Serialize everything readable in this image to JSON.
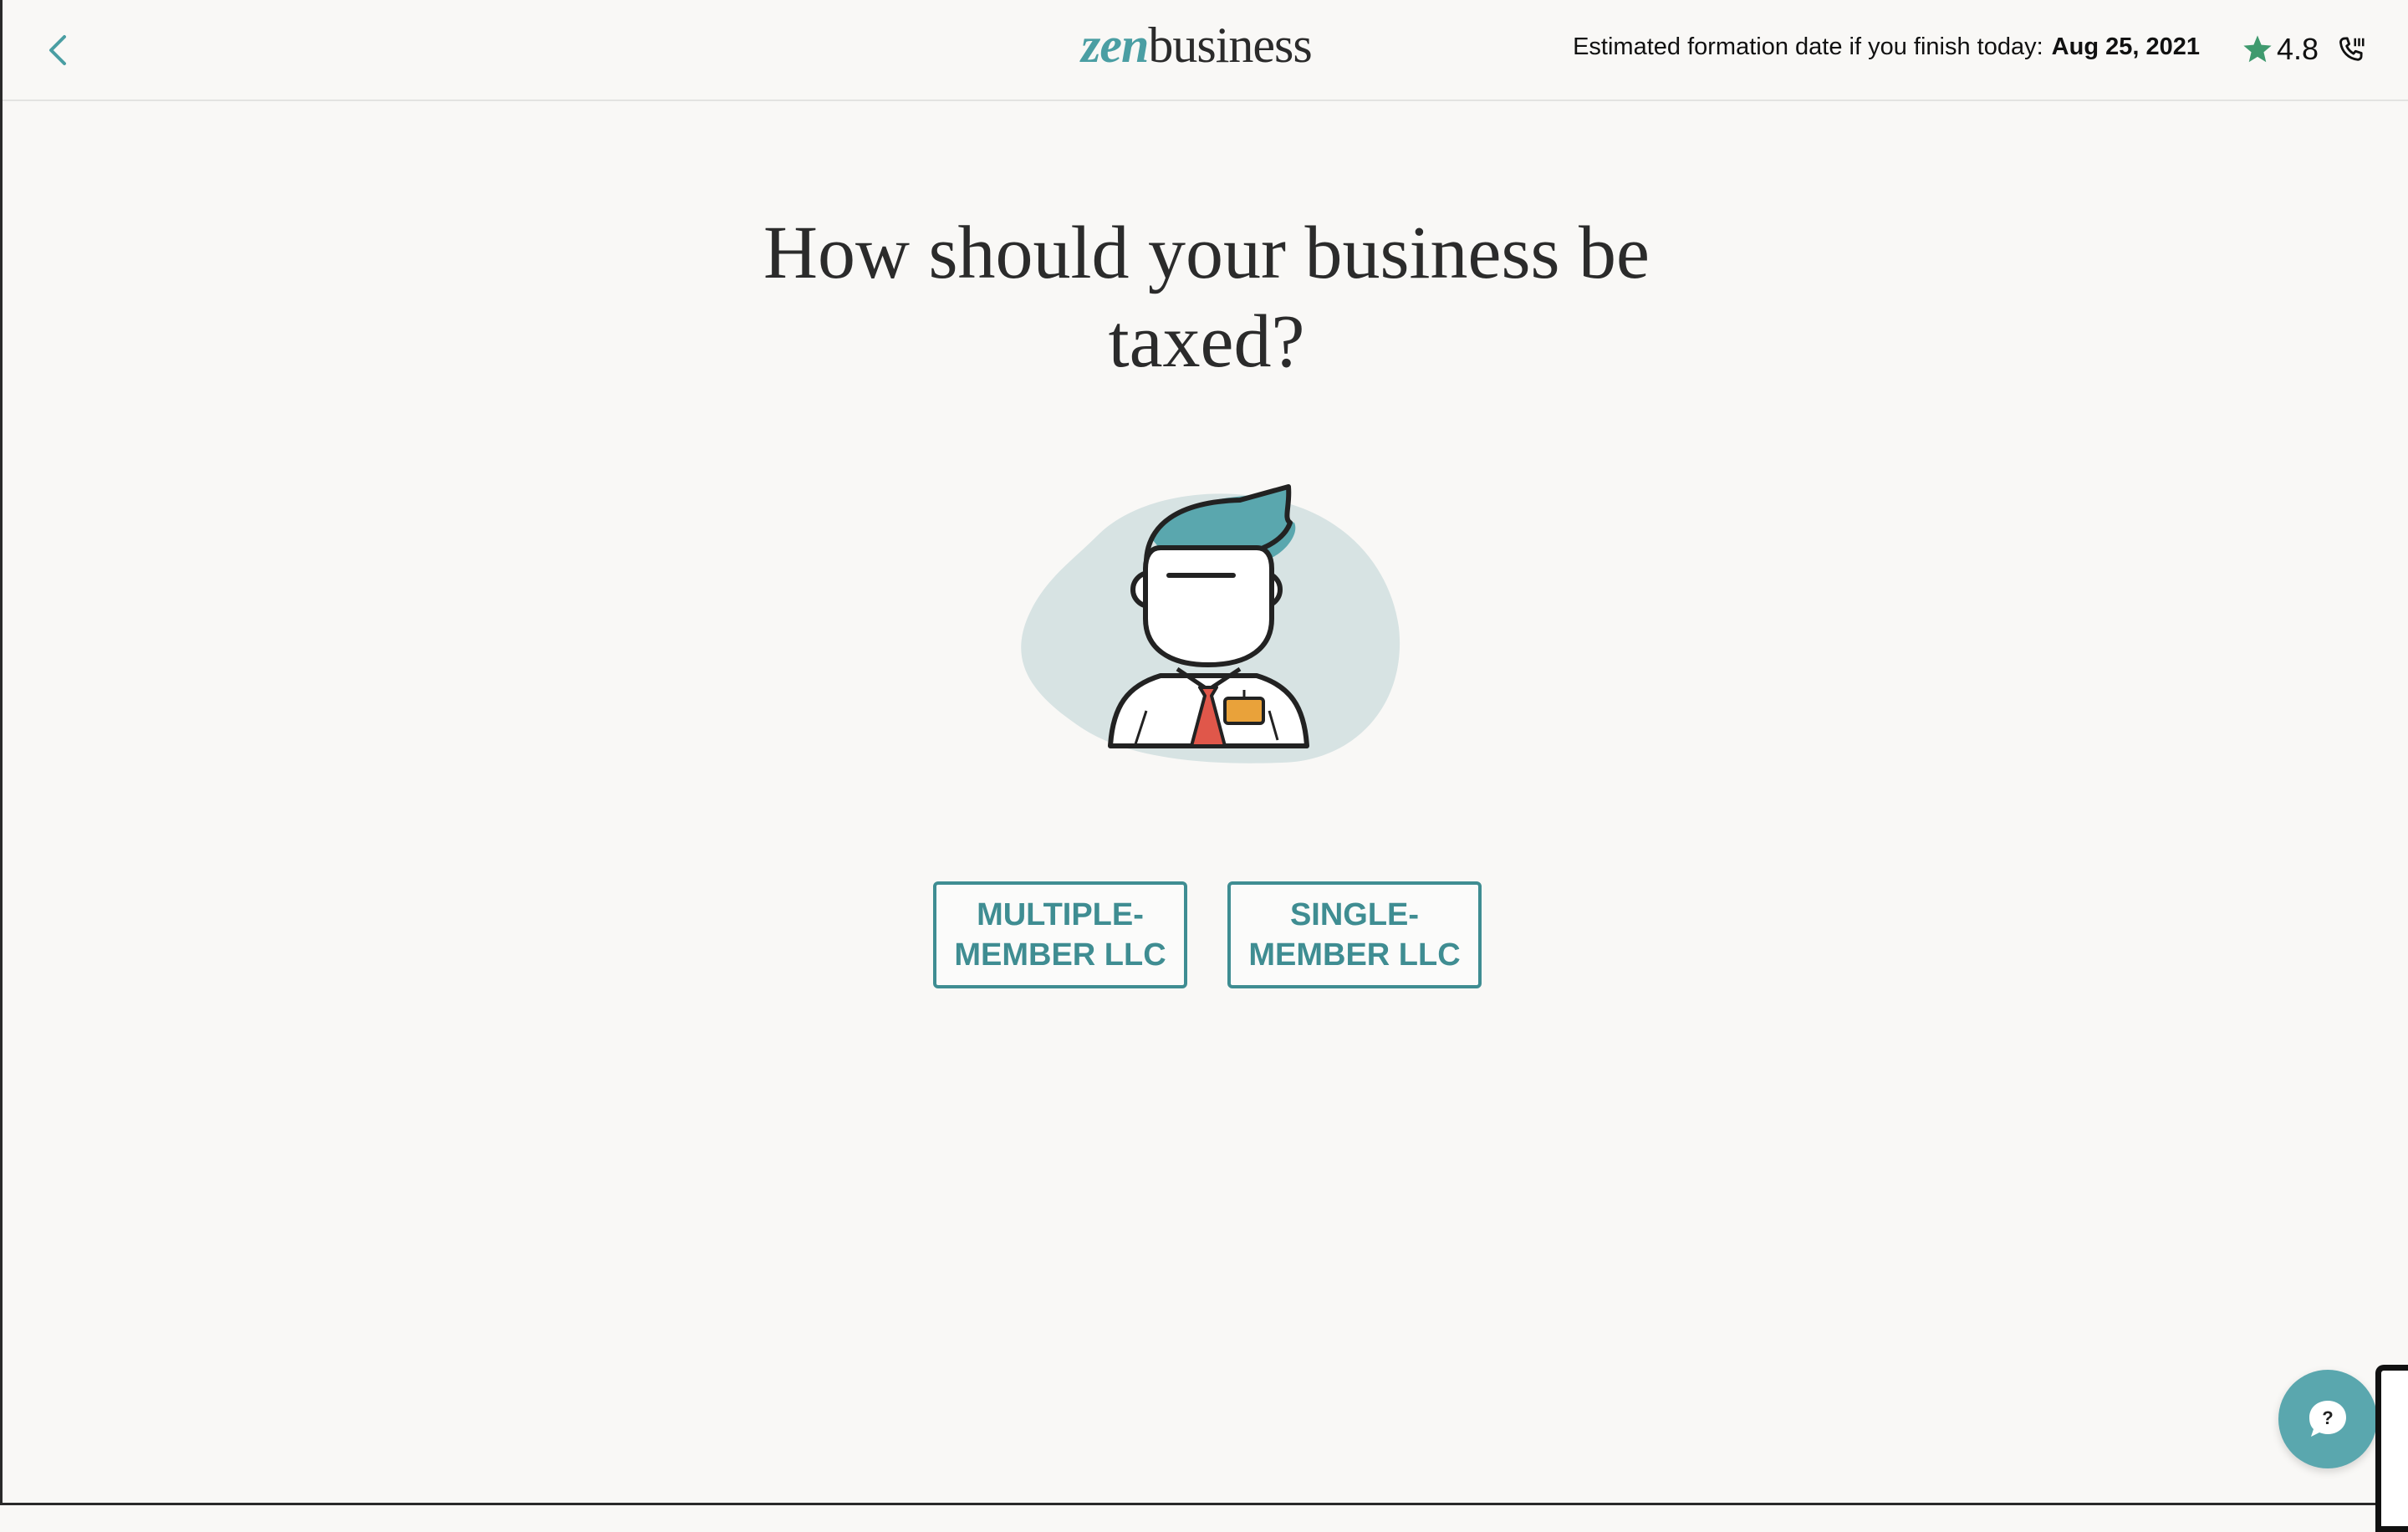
{
  "header": {
    "logo_prefix": "zen",
    "logo_suffix": "business",
    "estimate_label": "Estimated formation date if you finish today:",
    "estimate_date": "Aug 25, 2021",
    "rating": "4.8"
  },
  "main": {
    "question_line1": "How should your business be",
    "question_line2": "taxed?",
    "choices": [
      {
        "line1": "MULTIPLE-",
        "line2": "MEMBER LLC"
      },
      {
        "line1": "SINGLE-",
        "line2": "MEMBER LLC"
      }
    ]
  },
  "help": {
    "symbol": "?"
  },
  "icons": {
    "back": "chevron-left-icon",
    "star": "star-icon",
    "phone": "phone-icon",
    "help": "chat-question-icon"
  },
  "colors": {
    "brand_teal": "#4a9ea3",
    "button_teal": "#3f8d92",
    "star_green": "#3f9a6e",
    "background": "#f9f8f6"
  }
}
